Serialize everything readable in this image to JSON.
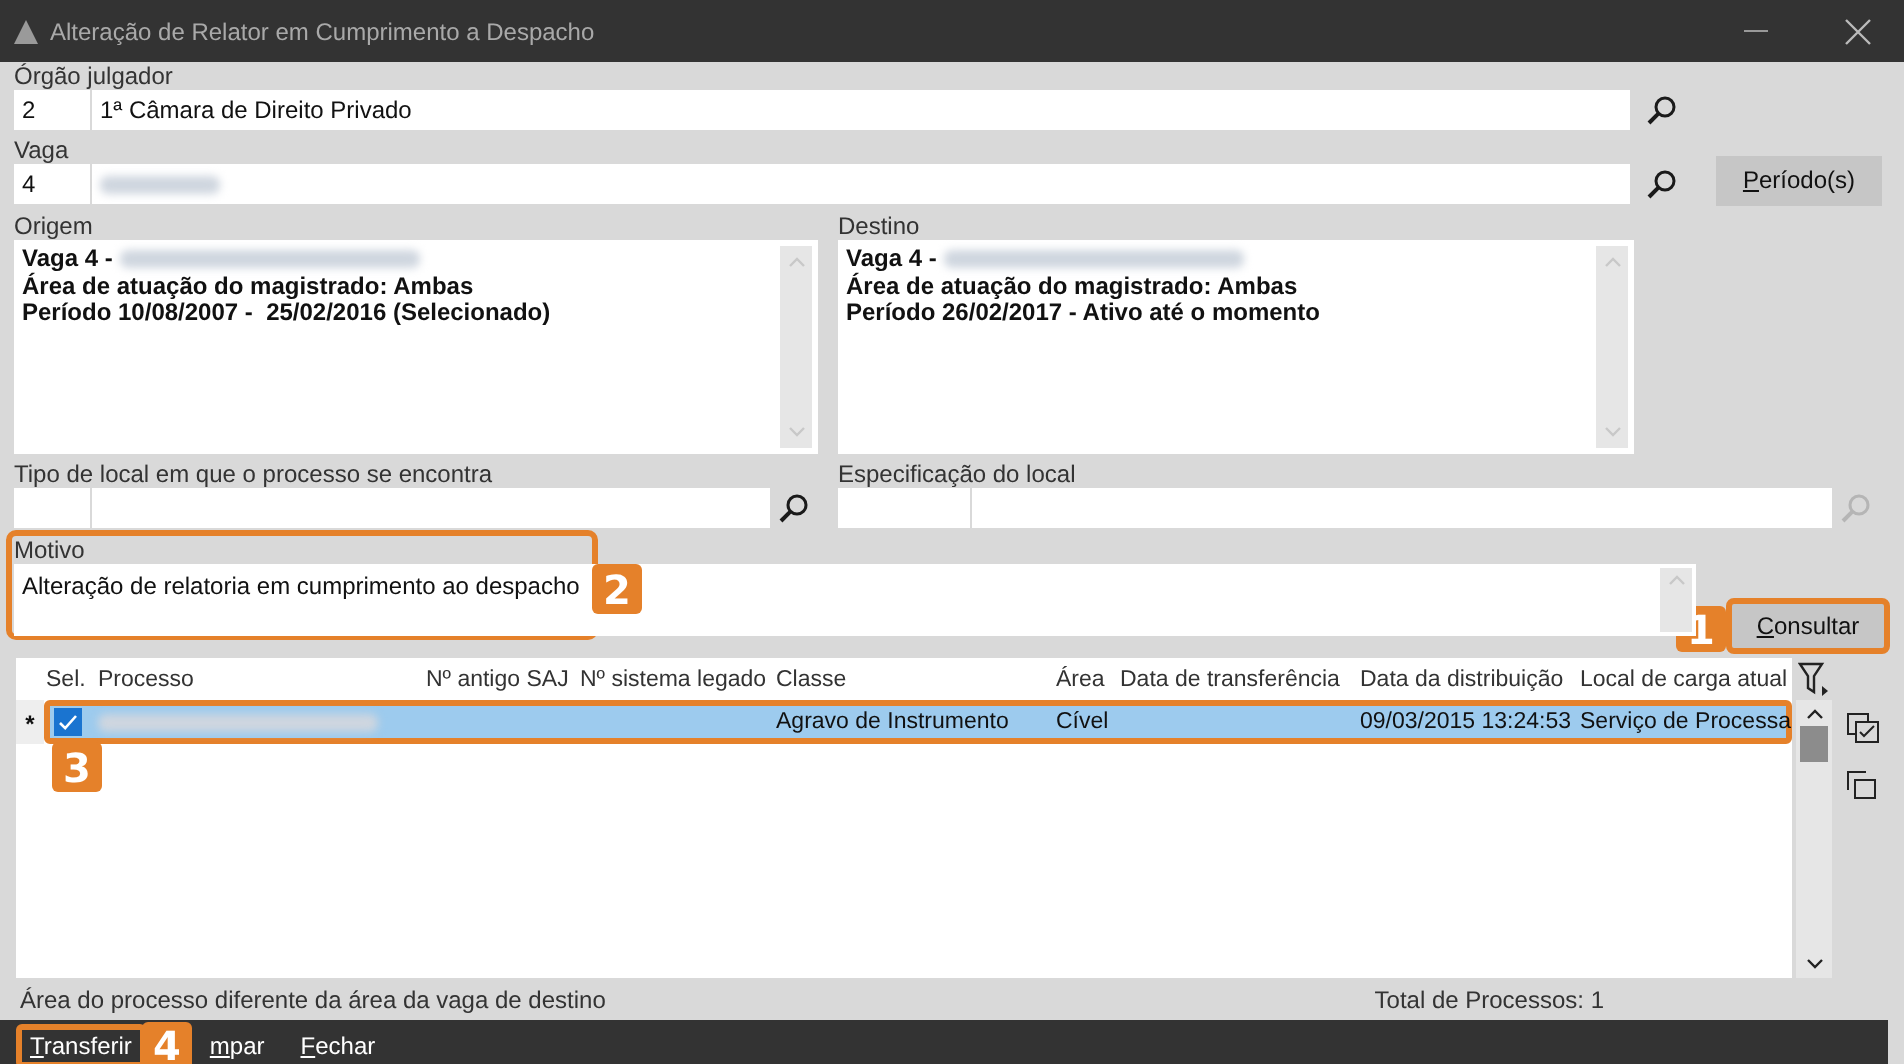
{
  "window": {
    "title": "Alteração de Relator em Cumprimento a Despacho"
  },
  "orgao_julgador": {
    "label": "Órgão julgador",
    "code": "2",
    "name": "1ª Câmara de Direito Privado"
  },
  "vaga": {
    "label": "Vaga",
    "code": "4",
    "name_redacted": true,
    "periodos_button": "Período(s)"
  },
  "origem": {
    "label": "Origem",
    "lines": [
      {
        "text": "Vaga 4 -",
        "redacted": true
      },
      {
        "text": "Área de atuação do magistrado: Ambas",
        "redacted": false
      },
      {
        "text": "Período 10/08/2007 -  25/02/2016 (Selecionado)",
        "redacted": false
      }
    ]
  },
  "destino": {
    "label": "Destino",
    "lines": [
      {
        "text": "Vaga 4 -",
        "redacted": true
      },
      {
        "text": "Área de atuação do magistrado: Ambas",
        "redacted": false
      },
      {
        "text": "Período 26/02/2017 - Ativo até o momento",
        "redacted": false
      }
    ]
  },
  "tipo_local": {
    "label": "Tipo de local em que o processo se encontra",
    "search_disabled": false
  },
  "especificacao_local": {
    "label": "Especificação do local",
    "search_disabled": true
  },
  "motivo": {
    "label": "Motivo",
    "value": "Alteração de relatoria em cumprimento ao despacho",
    "callout": "2"
  },
  "consultar_button": {
    "label": "Consultar",
    "callout": "1"
  },
  "table": {
    "columns": [
      "Sel.",
      "Processo",
      "Nº antigo SAJ",
      "Nº sistema legado",
      "Classe",
      "Área",
      "Data de transferência",
      "Data da distribuição",
      "Local de carga atual"
    ],
    "rows": [
      {
        "marker": "*",
        "selected": true,
        "callout": "3",
        "cells": [
          {
            "kind": "checkbox",
            "checked": true
          },
          {
            "kind": "redacted"
          },
          {
            "kind": "empty"
          },
          {
            "kind": "empty"
          },
          {
            "kind": "text",
            "text": "Agravo de Instrumento"
          },
          {
            "kind": "text",
            "text": "Cível"
          },
          {
            "kind": "empty"
          },
          {
            "kind": "text",
            "text": "09/03/2015 13:24:53"
          },
          {
            "kind": "text",
            "text": "Serviço de Processa"
          }
        ]
      }
    ]
  },
  "status_bar": {
    "message": "Área do processo diferente da área da vaga de destino",
    "total": "Total de Processos: 1"
  },
  "footer_buttons": [
    {
      "label": "Transferir",
      "callout": "4"
    },
    {
      "label": "mpar"
    },
    {
      "label": "Fechar"
    }
  ]
}
